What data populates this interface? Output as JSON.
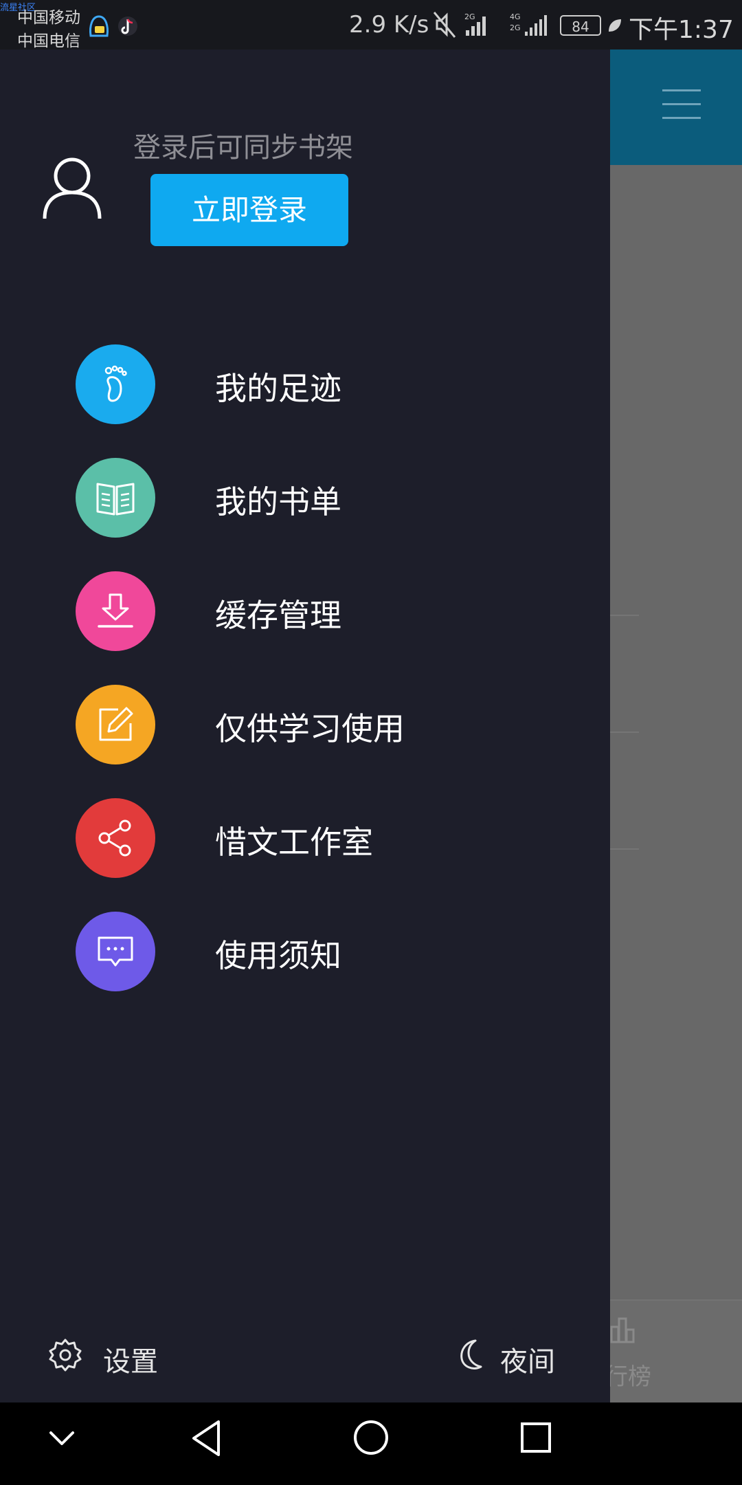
{
  "status_bar": {
    "tiny_text": "流星社区",
    "carrier_1": "中国移动",
    "carrier_2": "中国电信",
    "net_speed": "2.9 K/s",
    "battery": "84",
    "time": "下午1:37",
    "icons": [
      "qq-icon",
      "tiktok-icon",
      "mute-icon",
      "signal-2g-icon",
      "signal-4g-icon",
      "leaf-icon"
    ]
  },
  "background_app": {
    "menu_icon": "hamburger-icon",
    "bottom_tab_label": "行榜"
  },
  "drawer": {
    "login_hint": "登录后可同步书架",
    "login_button": "立即登录",
    "avatar_icon": "user-icon",
    "menu": [
      {
        "label": "我的足迹",
        "icon": "footprint-icon",
        "color": "#1aabee"
      },
      {
        "label": "我的书单",
        "icon": "book-icon",
        "color": "#5bbfa8"
      },
      {
        "label": "缓存管理",
        "icon": "download-icon",
        "color": "#f0489a"
      },
      {
        "label": "仅供学习使用",
        "icon": "edit-icon",
        "color": "#f5a623"
      },
      {
        "label": "惜文工作室",
        "icon": "share-icon",
        "color": "#e23b3b"
      },
      {
        "label": "使用须知",
        "icon": "message-icon",
        "color": "#6e5ae8"
      }
    ],
    "settings_label": "设置",
    "night_label": "夜间"
  },
  "nav_bar": {
    "icons": [
      "collapse-icon",
      "back-icon",
      "home-icon",
      "recents-icon"
    ]
  }
}
